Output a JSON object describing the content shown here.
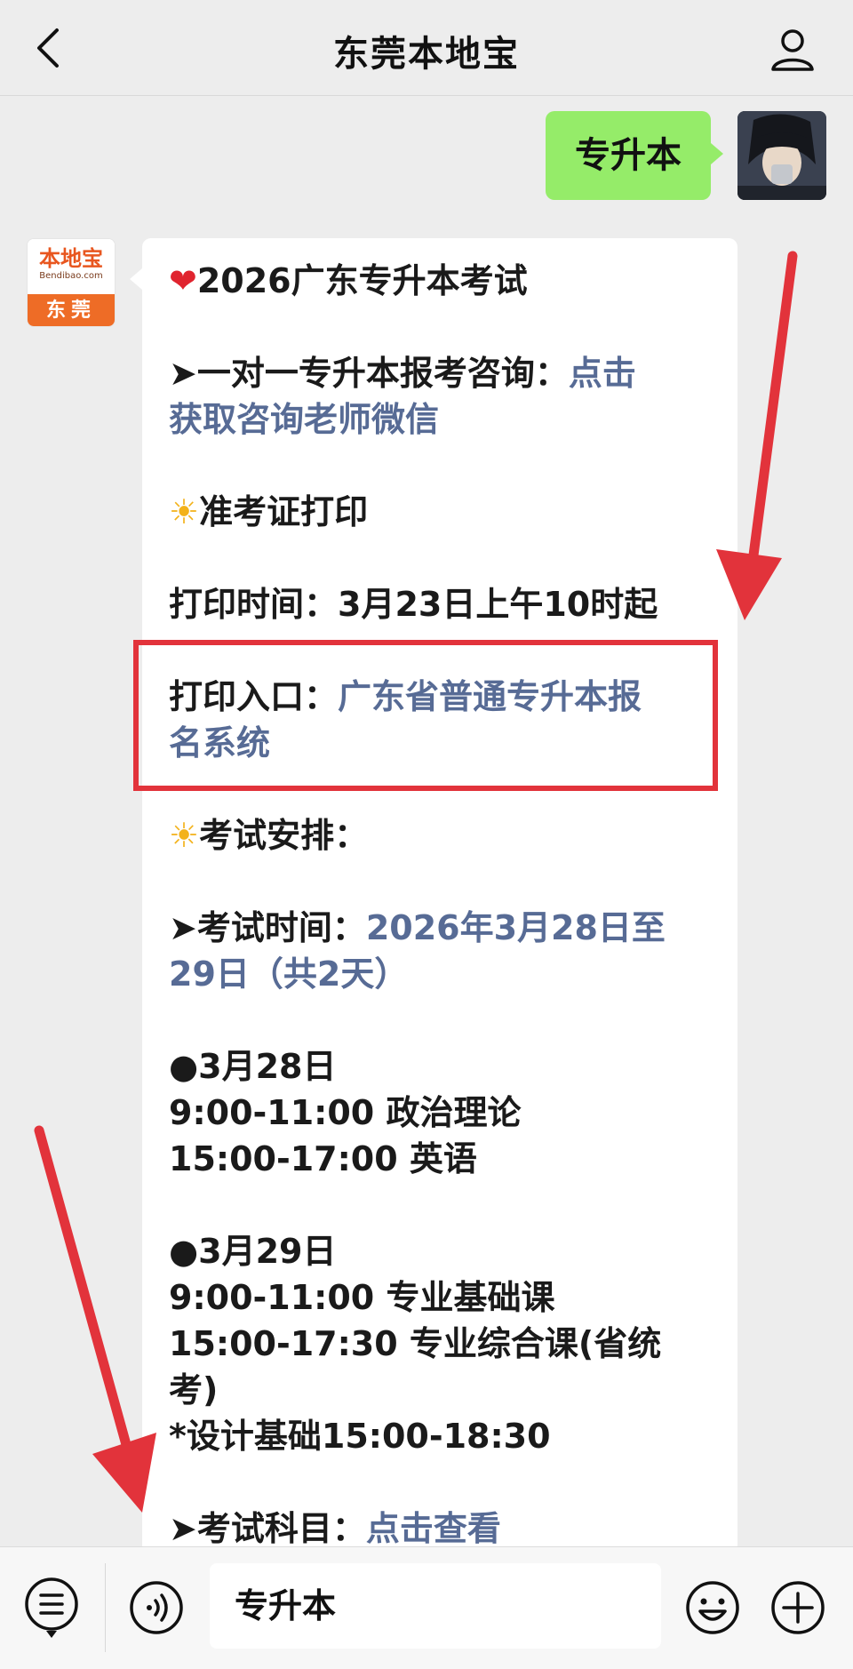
{
  "header": {
    "title": "东莞本地宝",
    "back_icon": "chevron-left-icon",
    "profile_icon": "person-icon"
  },
  "sent_message": {
    "text": "专升本"
  },
  "bot_avatar": {
    "logo_text": "本地宝",
    "logo_sub": "Bendibao.com",
    "city": "东莞"
  },
  "received_message": {
    "lines": [
      {
        "pre": "2026广东专升本考试",
        "link": ""
      },
      {
        "pre": "➤一对一专升本报考咨询：",
        "link": "点击"
      },
      {
        "pre": "",
        "link": "获取咨询老师微信"
      },
      {
        "pre": "准考证打印",
        "link": ""
      },
      {
        "pre": "打印时间：3月23日上午10时起",
        "link": ""
      },
      {
        "pre": "打印入口：",
        "link": "广东省普通专升本报"
      },
      {
        "pre": "",
        "link": "名系统"
      },
      {
        "pre": "考试安排：",
        "link": ""
      },
      {
        "pre": "➤考试时间：",
        "link": "2026年3月28日至"
      },
      {
        "pre": "",
        "link": "29日（共2天）"
      },
      {
        "pre": "●3月28日",
        "link": ""
      },
      {
        "pre": "9:00-11:00 政治理论",
        "link": ""
      },
      {
        "pre": "15:00-17:00 英语",
        "link": ""
      },
      {
        "pre": "●3月29日",
        "link": ""
      },
      {
        "pre": "9:00-11:00 专业基础课",
        "link": ""
      },
      {
        "pre": "15:00-17:30 专业综合课(省统",
        "link": ""
      },
      {
        "pre": "考)",
        "link": ""
      },
      {
        "pre": "*设计基础15:00-18:30",
        "link": ""
      },
      {
        "pre": "➤考试科目：",
        "link": "点击查看"
      }
    ],
    "heart_glyph": "❤",
    "sun_glyph": "☀"
  },
  "input_bar": {
    "text": "专升本",
    "icons": [
      "menu-icon",
      "voice-icon",
      "emoji-icon",
      "plus-icon"
    ]
  },
  "colors": {
    "background": "#ededed",
    "sent_bubble": "#95ec69",
    "link": "#576b95",
    "annotation_red": "#e2333b",
    "brand_orange": "#ee6c26"
  }
}
